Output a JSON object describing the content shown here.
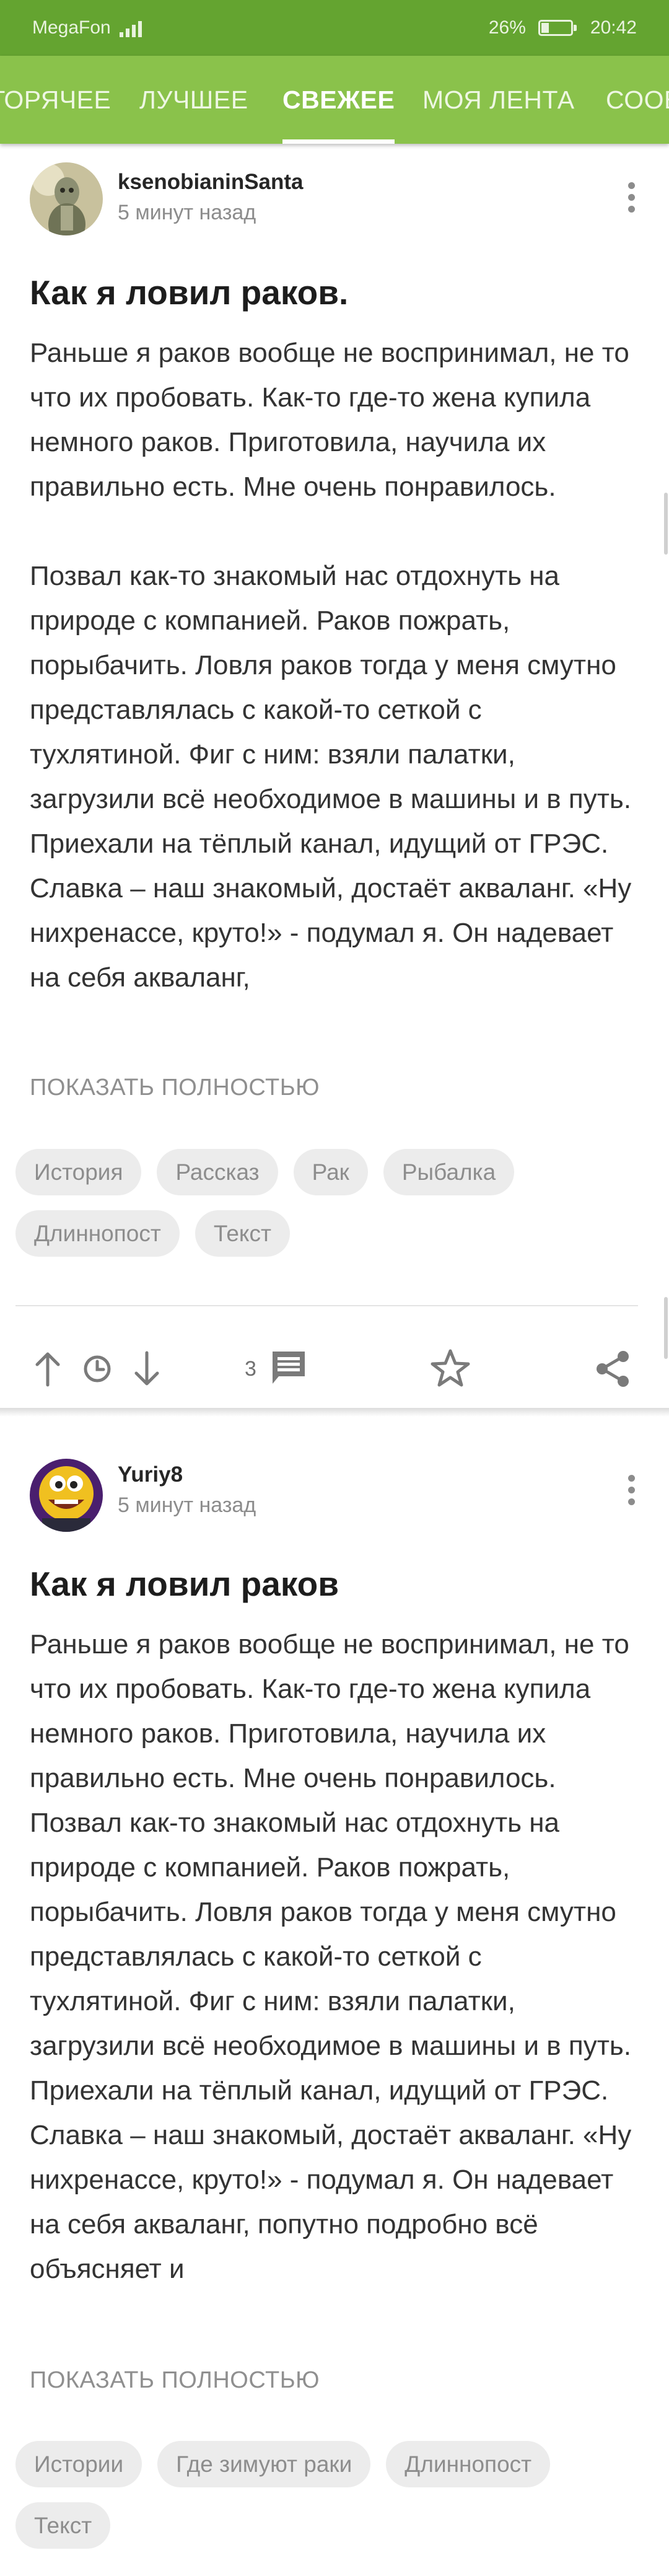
{
  "status_bar": {
    "carrier": "MegaFon",
    "battery_percent": "26%",
    "battery_level": 0.26,
    "time": "20:42"
  },
  "tabs": [
    {
      "label": "ГОРЯЧЕЕ"
    },
    {
      "label": "ЛУЧШЕЕ"
    },
    {
      "label": "СВЕЖЕЕ",
      "active": true
    },
    {
      "label": "МОЯ ЛЕНТА"
    },
    {
      "label": "СООБ"
    }
  ],
  "posts": [
    {
      "author": "ksenobianinSanta",
      "time": "5 минут назад",
      "title": "Как я ловил раков.",
      "paragraphs": [
        "Раньше я раков вообще не воспринимал, не то что их пробовать. Как-то где-то жена купила немного раков. Приготовила, научила их правильно есть. Мне очень понравилось.",
        "Позвал как-то знакомый нас отдохнуть на природе с компанией. Раков пожрать, порыбачить. Ловля раков тогда у меня смутно представлялась с какой-то сеткой с тухлятиной. Фиг с ним: взяли палатки, загрузили всё необходимое в машины и в путь. Приехали на тёплый канал, идущий от ГРЭС. Славка – наш знакомый, достаёт акваланг. «Ну нихренассе, круто!» - подумал я. Он надевает на себя акваланг,"
      ],
      "show_all": "ПОКАЗАТЬ ПОЛНОСТЬЮ",
      "tags": [
        "История",
        "Рассказ",
        "Рак",
        "Рыбалка",
        "Длиннопост",
        "Текст"
      ],
      "comments_count": "3"
    },
    {
      "author": "Yuriy8",
      "time": "5 минут назад",
      "title": "Как я ловил раков",
      "paragraphs": [
        "Раньше я раков вообще не воспринимал, не то что их пробовать. Как-то где-то жена купила немного раков. Приготовила, научила их правильно есть. Мне очень понравилось.\nПозвал как-то знакомый нас отдохнуть на природе с компанией. Раков пожрать, порыбачить. Ловля раков тогда у меня смутно представлялась с какой-то сеткой с тухлятиной. Фиг с ним: взяли палатки, загрузили всё необходимое в машины и в путь. Приехали на тёплый канал, идущий от ГРЭС. Славка – наш знакомый, достаёт акваланг. «Ну нихренассе, круто!» - подумал я. Он надевает на себя акваланг, попутно подробно всё объясняет и"
      ],
      "show_all": "ПОКАЗАТЬ ПОЛНОСТЬЮ",
      "tags": [
        "Истории",
        "Где зимуют раки",
        "Длиннопост",
        "Текст"
      ]
    }
  ],
  "icons": {
    "upvote": "arrow-up-icon",
    "later": "clock-icon",
    "downvote": "arrow-down-icon",
    "comments": "comment-icon",
    "save": "star-icon",
    "share": "share-icon",
    "menu": "more-vertical-icon"
  },
  "colors": {
    "status_bar": "#64a430",
    "tab_bar": "#8ac24b",
    "tag_bg": "#ececec",
    "muted_text": "#8c8c8c"
  }
}
